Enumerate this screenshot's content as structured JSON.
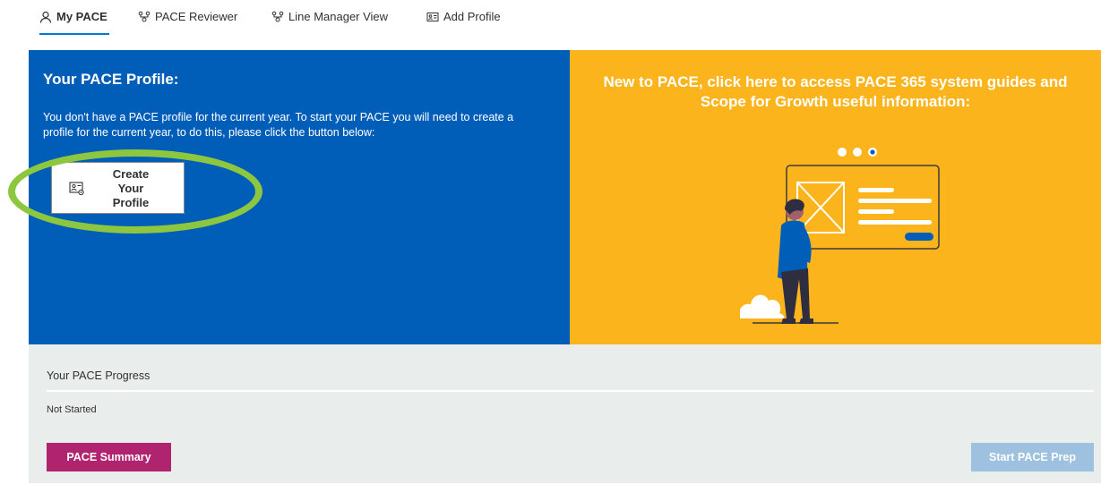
{
  "tabs": [
    {
      "label": "My PACE",
      "icon": "person-icon",
      "active": true
    },
    {
      "label": "PACE Reviewer",
      "icon": "org-chart-icon"
    },
    {
      "label": "Line Manager View",
      "icon": "org-chart-icon"
    },
    {
      "label": "Add Profile",
      "icon": "contact-card-icon"
    }
  ],
  "profile": {
    "heading": "Your PACE Profile:",
    "message": "You don't have a PACE profile for the current year. To start your PACE you will need to create a profile for the current year, to do this, please click the button below:",
    "create_button_label": "Create Your Profile",
    "create_button_icon": "contact-settings-icon"
  },
  "guides": {
    "heading": "New to PACE, click here to access PACE 365 system guides and Scope for Growth useful information:",
    "illustration": "person-presenting-illustration"
  },
  "progress": {
    "title": "Your PACE Progress",
    "status": "Not Started",
    "summary_button": "PACE Summary",
    "start_button": "Start PACE Prep"
  },
  "colors": {
    "blue_panel": "#005eb8",
    "yellow_panel": "#fbb41c",
    "progress_panel": "#e9edec",
    "summary_button": "#b0236e",
    "start_button_disabled": "#9ec1e0",
    "highlight_ring": "#8dc63f",
    "active_tab_underline": "#0078d4"
  }
}
